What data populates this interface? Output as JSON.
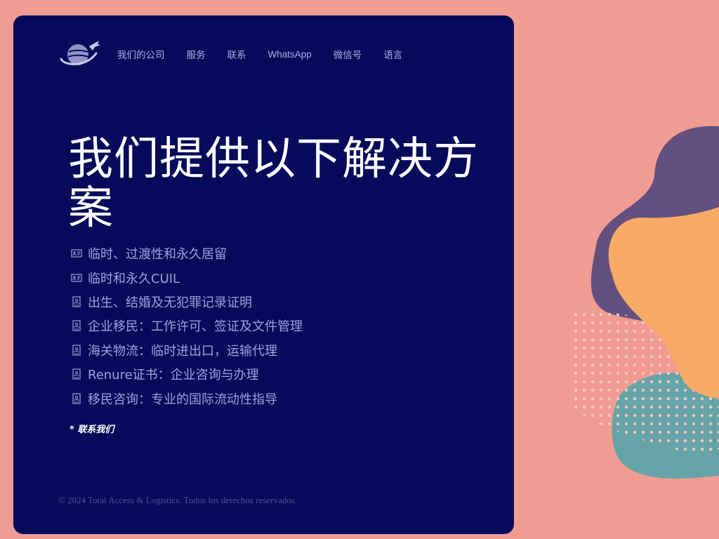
{
  "brand": {
    "logo_icon": "globe-airplane-logo"
  },
  "nav": {
    "items": [
      {
        "label": "我们的公司"
      },
      {
        "label": "服务"
      },
      {
        "label": "联系"
      },
      {
        "label": "WhatsApp"
      },
      {
        "label": "微信号"
      },
      {
        "label": "语言"
      }
    ]
  },
  "hero": {
    "title": "我们提供以下解决方案"
  },
  "services": [
    {
      "icon": "id-card-icon",
      "text": "临时、过渡性和永久居留"
    },
    {
      "icon": "id-card-icon",
      "text": "临时和永久CUIL"
    },
    {
      "icon": "document-icon",
      "text": "出生、结婚及无犯罪记录证明"
    },
    {
      "icon": "document-icon",
      "text": "企业移民：工作许可、签证及文件管理"
    },
    {
      "icon": "document-icon",
      "text": "海关物流：临时进出口，运输代理"
    },
    {
      "icon": "document-icon",
      "text": "Renure证书：企业咨询与办理"
    },
    {
      "icon": "document-icon",
      "text": "移民咨询：专业的国际流动性指导"
    }
  ],
  "cta": {
    "label": "* 联系我们"
  },
  "footer": {
    "copyright": "© 2024 Total Access & Logistics. Todos los derechos reservados."
  },
  "colors": {
    "background": "#f19c93",
    "card": "#050b5a",
    "blob_purple": "#64507e",
    "blob_orange": "#f7ab66",
    "blob_teal": "#65a4a6"
  }
}
